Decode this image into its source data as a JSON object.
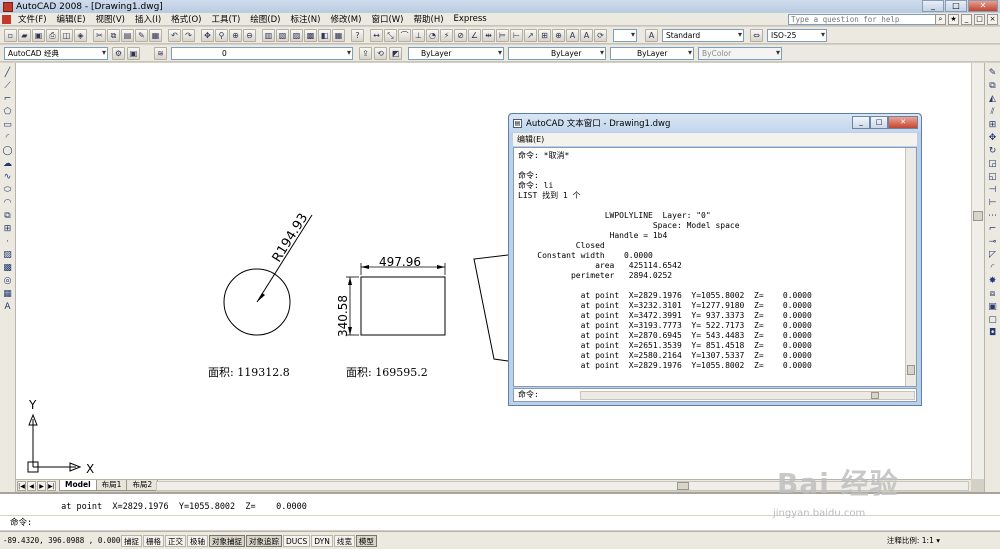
{
  "window": {
    "title": "AutoCAD 2008 - [Drawing1.dwg]",
    "min": "_",
    "max": "□",
    "close": "✕"
  },
  "menu": {
    "items": [
      "文件(F)",
      "编辑(E)",
      "视图(V)",
      "插入(I)",
      "格式(O)",
      "工具(T)",
      "绘图(D)",
      "标注(N)",
      "修改(M)",
      "窗口(W)",
      "帮助(H)",
      "Express"
    ],
    "help_placeholder": "Type a question for help"
  },
  "toolbar": {
    "workspace": "AutoCAD 经典",
    "layer": "0",
    "color": "ByLayer",
    "linetype": "ByLayer",
    "lineweight": "ByLayer",
    "plotstyle": "ByColor",
    "text_style": "Standard",
    "dim_style": "ISO-25"
  },
  "drawing": {
    "circle_dim": "R194.93",
    "rect_width_dim": "497.96",
    "rect_height_dim": "340.58",
    "circle_area": "面积: 119312.8",
    "rect_area": "面积: 169595.2",
    "ucs_x": "X",
    "ucs_y": "Y"
  },
  "tabs": [
    "Model",
    "布局1",
    "布局2"
  ],
  "text_window": {
    "title": "AutoCAD 文本窗口 - Drawing1.dwg",
    "menu": "编辑(E)",
    "lines": [
      "命令: *取消*",
      "",
      "命令:",
      "命令: li",
      "LIST 找到 1 个",
      "",
      "                  LWPOLYLINE  Layer: \"0\"",
      "                            Space: Model space",
      "                   Handle = 1b4",
      "            Closed",
      "    Constant width    0.0000",
      "                area   425114.6542",
      "           perimeter   2894.0252",
      "",
      "             at point  X=2829.1976  Y=1055.8002  Z=    0.0000",
      "             at point  X=3232.3101  Y=1277.9180  Z=    0.0000",
      "             at point  X=3472.3991  Y= 937.3373  Z=    0.0000",
      "             at point  X=3193.7773  Y= 522.7173  Z=    0.0000",
      "             at point  X=2870.6945  Y= 543.4483  Z=    0.0000",
      "             at point  X=2651.3539  Y= 851.4518  Z=    0.0000",
      "             at point  X=2580.2164  Y=1307.5337  Z=    0.0000",
      "             at point  X=2829.1976  Y=1055.8002  Z=    0.0000"
    ],
    "prompt": "命令:"
  },
  "command_line": {
    "history": "          at point  X=2829.1976  Y=1055.8002  Z=    0.0000",
    "prompt": "命令:"
  },
  "status_bar": {
    "coords": "-89.4320, 396.0988 , 0.0000",
    "toggles": [
      "捕捉",
      "栅格",
      "正交",
      "极轴",
      "对象捕捉",
      "对象追踪",
      "DUCS",
      "DYN",
      "线宽",
      "模型"
    ],
    "annotation_scale": "注释比例: 1:1 ▾"
  },
  "watermark": {
    "brand": "Bai 经验",
    "url": "jingyan.baidu.com"
  }
}
